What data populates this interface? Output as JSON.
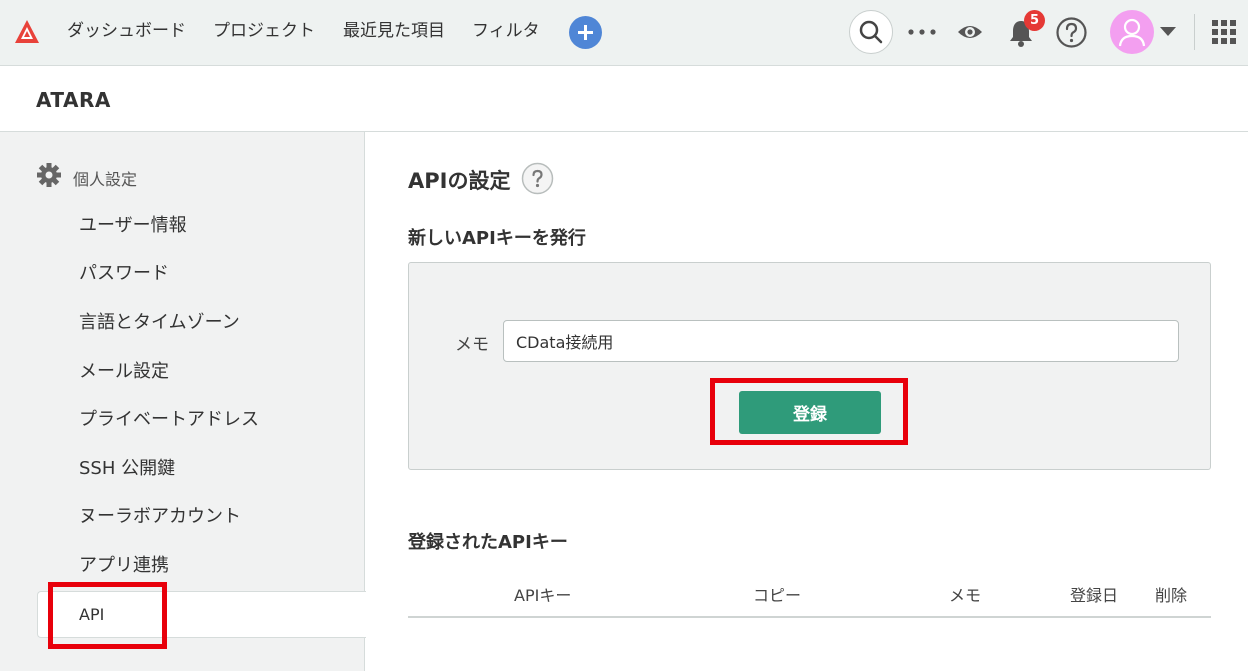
{
  "topbar": {
    "logo": "backlog-logo",
    "nav": [
      "ダッシュボード",
      "プロジェクト",
      "最近見た項目",
      "フィルタ"
    ],
    "add_icon": "plus-icon",
    "notification_count": "5",
    "icons": [
      "search-icon",
      "more-dots-icon",
      "eye-icon",
      "bell-icon",
      "help-icon",
      "avatar-icon",
      "chevron-down-icon",
      "apps-grid-icon"
    ]
  },
  "space": {
    "name": "ATARA"
  },
  "sidebar": {
    "section_icon": "gear-icon",
    "section_label": "個人設定",
    "items": [
      {
        "label": "ユーザー情報"
      },
      {
        "label": "パスワード"
      },
      {
        "label": "言語とタイムゾーン"
      },
      {
        "label": "メール設定"
      },
      {
        "label": "プライベートアドレス"
      },
      {
        "label": "SSH 公開鍵"
      },
      {
        "label": "ヌーラボアカウント"
      },
      {
        "label": "アプリ連携"
      },
      {
        "label": "API"
      }
    ],
    "active_item": "API"
  },
  "main": {
    "title": "APIの設定",
    "new_key_section": "新しいAPIキーを発行",
    "memo_label": "メモ",
    "memo_value": "CData接続用",
    "register_label": "登録",
    "registered_section": "登録されたAPIキー",
    "table_headers": [
      "APIキー",
      "コピー",
      "メモ",
      "登録日",
      "削除"
    ]
  },
  "colors": {
    "primary_button": "#2f9b7a",
    "highlight": "#e8000b",
    "badge": "#e53935",
    "add_button": "#4f86d6",
    "avatar": "#f39ff0"
  }
}
